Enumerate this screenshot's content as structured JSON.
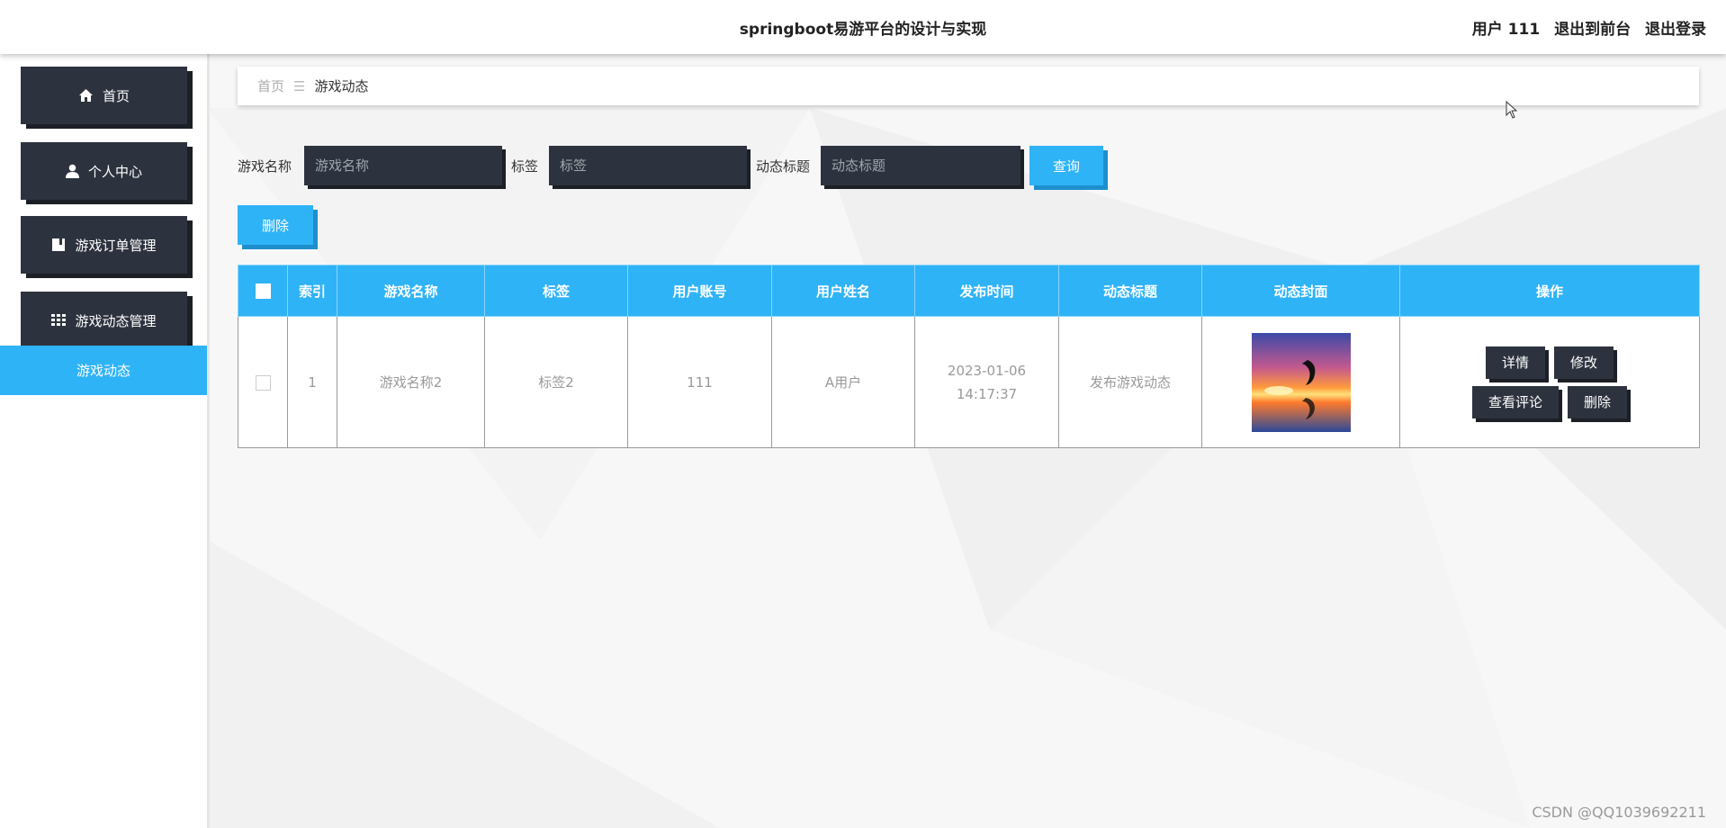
{
  "header": {
    "title": "springboot易游平台的设计与实现",
    "user_label": "用户 111",
    "to_front": "退出到前台",
    "logout": "退出登录"
  },
  "sidebar": {
    "items": [
      {
        "label": "首页",
        "icon": "home-icon"
      },
      {
        "label": "个人中心",
        "icon": "user-icon"
      },
      {
        "label": "游戏订单管理",
        "icon": "book-icon"
      },
      {
        "label": "游戏动态管理",
        "icon": "grid-icon"
      }
    ],
    "active_sub": "游戏动态"
  },
  "breadcrumb": {
    "home": "首页",
    "separator": "☰",
    "current": "游戏动态"
  },
  "search": {
    "game_name_label": "游戏名称",
    "game_name_placeholder": "游戏名称",
    "tag_label": "标签",
    "tag_placeholder": "标签",
    "title_label": "动态标题",
    "title_placeholder": "动态标题",
    "query_button": "查询"
  },
  "delete_button": "删除",
  "table": {
    "headers": [
      "索引",
      "游戏名称",
      "标签",
      "用户账号",
      "用户姓名",
      "发布时间",
      "动态标题",
      "动态封面",
      "操作"
    ],
    "rows": [
      {
        "index": "1",
        "game_name": "游戏名称2",
        "tag": "标签2",
        "account": "111",
        "user_name": "A用户",
        "publish_time": "2023-01-06 14:17:37",
        "post_title": "发布游戏动态",
        "actions": {
          "detail": "详情",
          "edit": "修改",
          "comments": "查看评论",
          "delete": "删除"
        }
      }
    ]
  },
  "watermark": "CSDN @QQ1039692211",
  "colors": {
    "accent": "#2fb3f7",
    "dark": "#2d333e"
  }
}
